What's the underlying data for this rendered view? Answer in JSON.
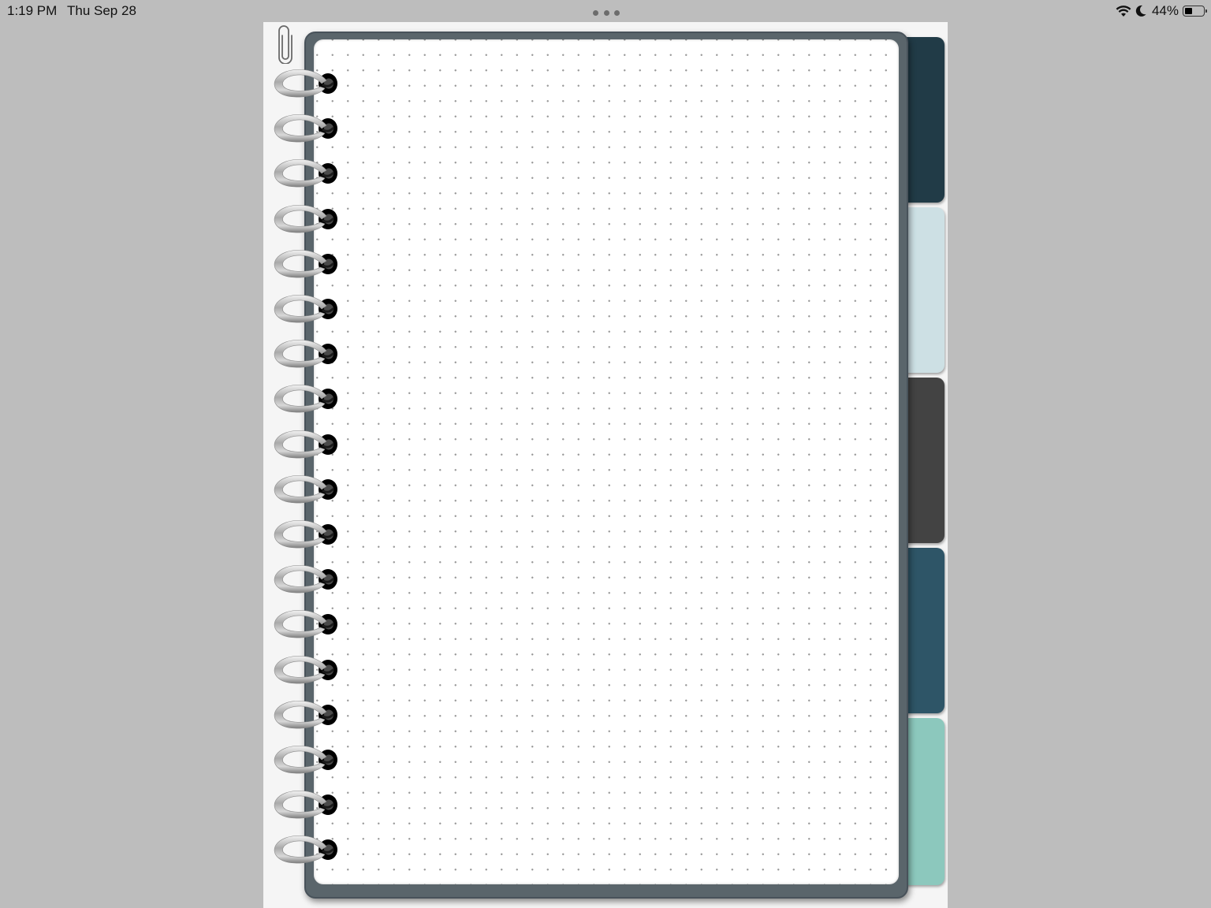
{
  "status_bar": {
    "time": "1:19 PM",
    "date": "Thu Sep 28",
    "battery_percent": "44%",
    "battery_level": 0.44,
    "icons": [
      "wifi-icon",
      "do-not-disturb-moon-icon",
      "battery-icon"
    ]
  },
  "multitask_indicator": {
    "icon": "three-dots-icon"
  },
  "notebook": {
    "paper_style": "dot-grid",
    "ring_count": 18,
    "attachment_icon": "paperclip-icon",
    "tabs": [
      {
        "color": "#213b47"
      },
      {
        "color": "#cde0e4"
      },
      {
        "color": "#434343"
      },
      {
        "color": "#2e5567"
      },
      {
        "color": "#8cc8bd"
      }
    ]
  },
  "colors": {
    "background": "#bdbdbd",
    "cover": "#5a656b",
    "paper": "#ffffff"
  }
}
